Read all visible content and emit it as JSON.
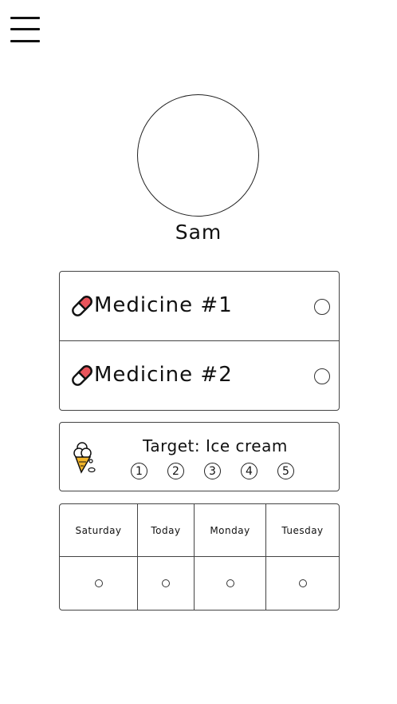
{
  "user": {
    "name": "Sam"
  },
  "medicines": [
    {
      "label": "Medicine #1",
      "icon": "pill-icon"
    },
    {
      "label": "Medicine #2",
      "icon": "pill-icon"
    }
  ],
  "target": {
    "label": "Target: Ice cream",
    "icon": "ice-cream-icon",
    "steps": [
      "1",
      "2",
      "3",
      "4",
      "5"
    ]
  },
  "days": [
    "Saturday",
    "Today",
    "Monday",
    "Tuesday"
  ],
  "colors": {
    "pill_red": "#e9545b",
    "cone": "#f2b52a"
  }
}
